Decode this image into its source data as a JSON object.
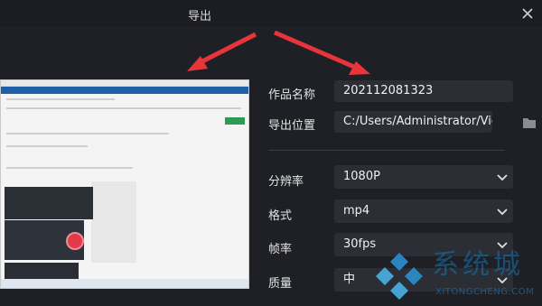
{
  "window": {
    "title": "导出"
  },
  "preview": {
    "icon": "screenshot-thumbnail"
  },
  "form": {
    "name_label": "作品名称",
    "name_value": "202112081323",
    "location_label": "导出位置",
    "location_value": "C:/Users/Administrator/Vide",
    "resolution_label": "分辨率",
    "resolution_value": "1080P",
    "format_label": "格式",
    "format_value": "mp4",
    "framerate_label": "帧率",
    "framerate_value": "30fps",
    "quality_label": "质量",
    "quality_value": "中"
  },
  "watermark": {
    "text": "系统城",
    "sub": "XITONGCHENG.COM"
  },
  "colors": {
    "background": "#1e2026",
    "field": "#2b2e35",
    "arrow": "#e8353b",
    "watermark": "#1478b4"
  }
}
